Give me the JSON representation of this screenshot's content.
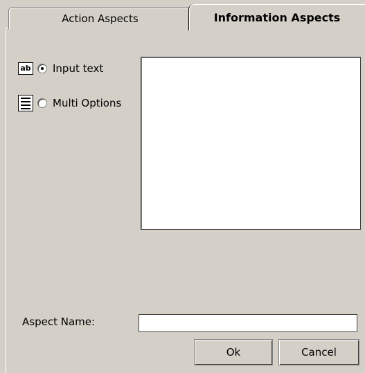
{
  "tabs": [
    {
      "label": "Action Aspects",
      "active": false
    },
    {
      "label": "Information Aspects",
      "active": true
    }
  ],
  "types": [
    {
      "icon": "text-field-icon",
      "icon_text": "ab",
      "label": "Input text",
      "checked": true
    },
    {
      "icon": "list-icon",
      "label": "Multi Options",
      "checked": false
    }
  ],
  "form": {
    "aspect_name_label": "Aspect Name:",
    "aspect_name_value": ""
  },
  "buttons": {
    "ok": "Ok",
    "cancel": "Cancel"
  }
}
